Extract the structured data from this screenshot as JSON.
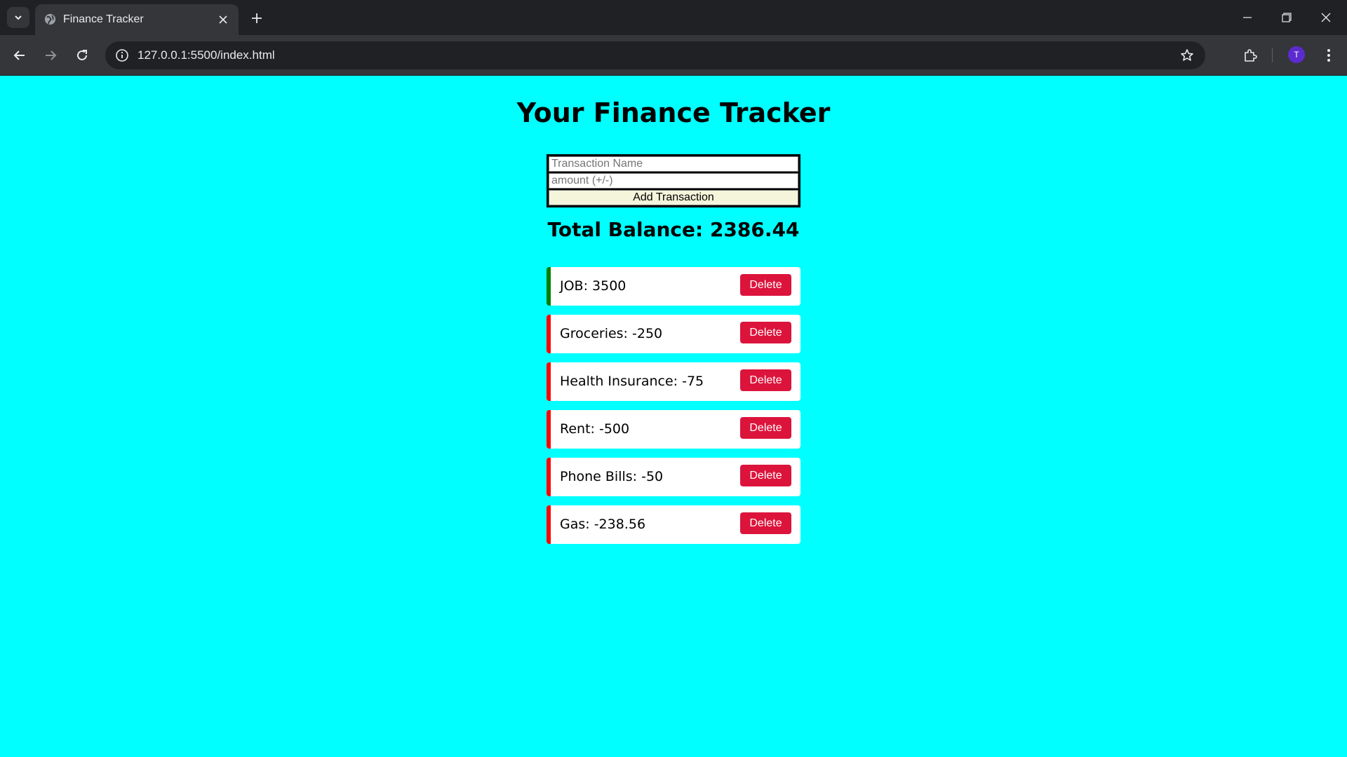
{
  "browser": {
    "tab_title": "Finance Tracker",
    "url": "127.0.0.1:5500/index.html",
    "profile_initial": "T"
  },
  "page": {
    "title": "Your Finance Tracker",
    "form": {
      "name_placeholder": "Transaction Name",
      "amount_placeholder": "amount (+/-)",
      "add_label": "Add Transaction"
    },
    "balance": "Total Balance: 2386.44",
    "delete_label": "Delete",
    "transactions": [
      {
        "text": "JOB: 3500",
        "type": "income"
      },
      {
        "text": "Groceries: -250",
        "type": "expense"
      },
      {
        "text": "Health Insurance: -75",
        "type": "expense"
      },
      {
        "text": "Rent: -500",
        "type": "expense"
      },
      {
        "text": "Phone Bills: -50",
        "type": "expense"
      },
      {
        "text": "Gas: -238.56",
        "type": "expense"
      }
    ]
  },
  "colors": {
    "background": "#00ffff",
    "income_border": "#008000",
    "expense_border": "#ff0000",
    "delete_button": "#dc143c",
    "add_button": "#f5f5dc"
  },
  "icons": [
    "tab-list-icon",
    "globe-icon",
    "close-icon",
    "plus-icon",
    "minimize-icon",
    "restore-icon",
    "back-icon",
    "forward-icon",
    "reload-icon",
    "site-info-icon",
    "star-icon",
    "extensions-icon",
    "more-icon"
  ]
}
